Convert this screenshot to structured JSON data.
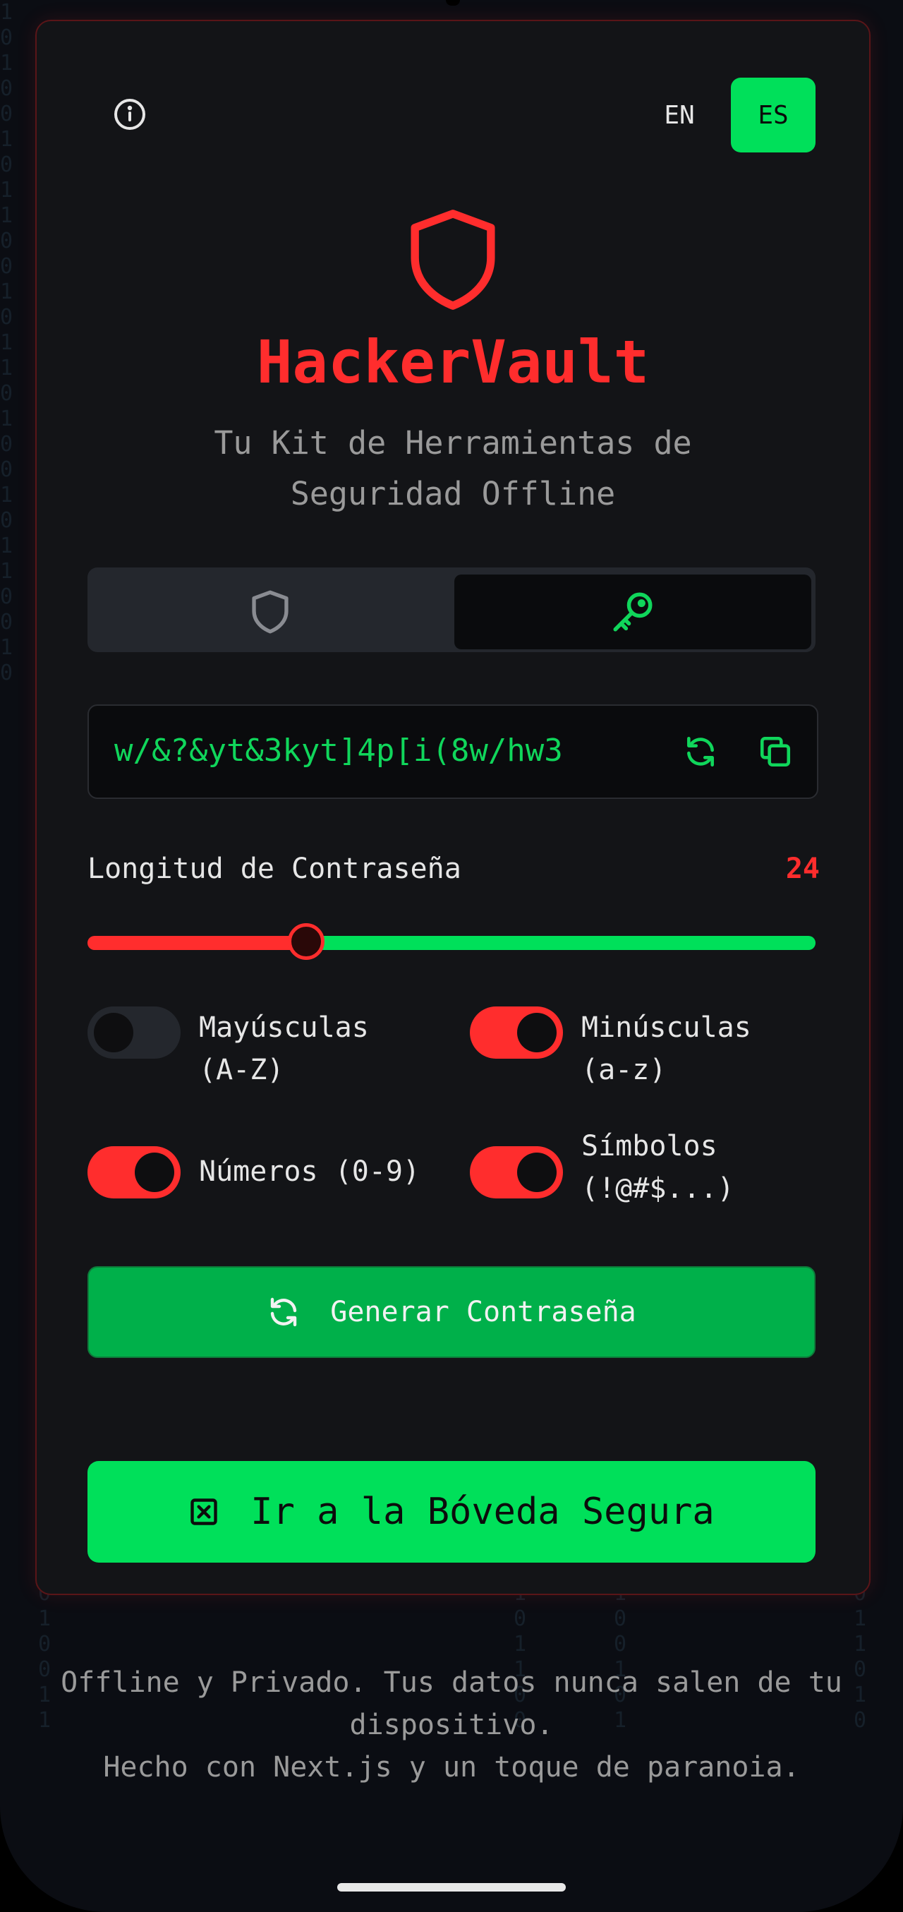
{
  "header": {
    "info_icon": "info-icon",
    "languages": [
      {
        "code": "EN",
        "active": false
      },
      {
        "code": "ES",
        "active": true
      }
    ]
  },
  "brand": {
    "logo_icon": "shield-icon",
    "title": "HackerVault",
    "subtitle": "Tu Kit de Herramientas de Seguridad Offline"
  },
  "tabs": [
    {
      "icon": "shield-icon",
      "active": false
    },
    {
      "icon": "key-icon",
      "active": true
    }
  ],
  "generator": {
    "password": "w/&?&yt&3kyt]4p[i(8w/hw3",
    "refresh_icon": "refresh-icon",
    "copy_icon": "copy-icon",
    "length_label": "Longitud de Contraseña",
    "length_value": "24",
    "slider_fraction": 0.3,
    "options": [
      {
        "label": "Mayúsculas (A-Z)",
        "enabled": false
      },
      {
        "label": "Minúsculas (a-z)",
        "enabled": true
      },
      {
        "label": "Números (0-9)",
        "enabled": true
      },
      {
        "label": "Símbolos (!@#$...)",
        "enabled": true
      }
    ],
    "generate_label": "Generar Contraseña"
  },
  "vault_button": {
    "label": "Ir a la Bóveda Segura",
    "icon": "square-x-icon"
  },
  "footer": {
    "line1": "Offline y Privado. Tus datos nunca salen de tu dispositivo.",
    "line2": "Hecho con Next.js y un toque de paranoia."
  },
  "colors": {
    "accent_red": "#ff2d2d",
    "accent_green": "#00e05a",
    "card_bg": "#131417",
    "page_bg": "#0b0d13"
  }
}
